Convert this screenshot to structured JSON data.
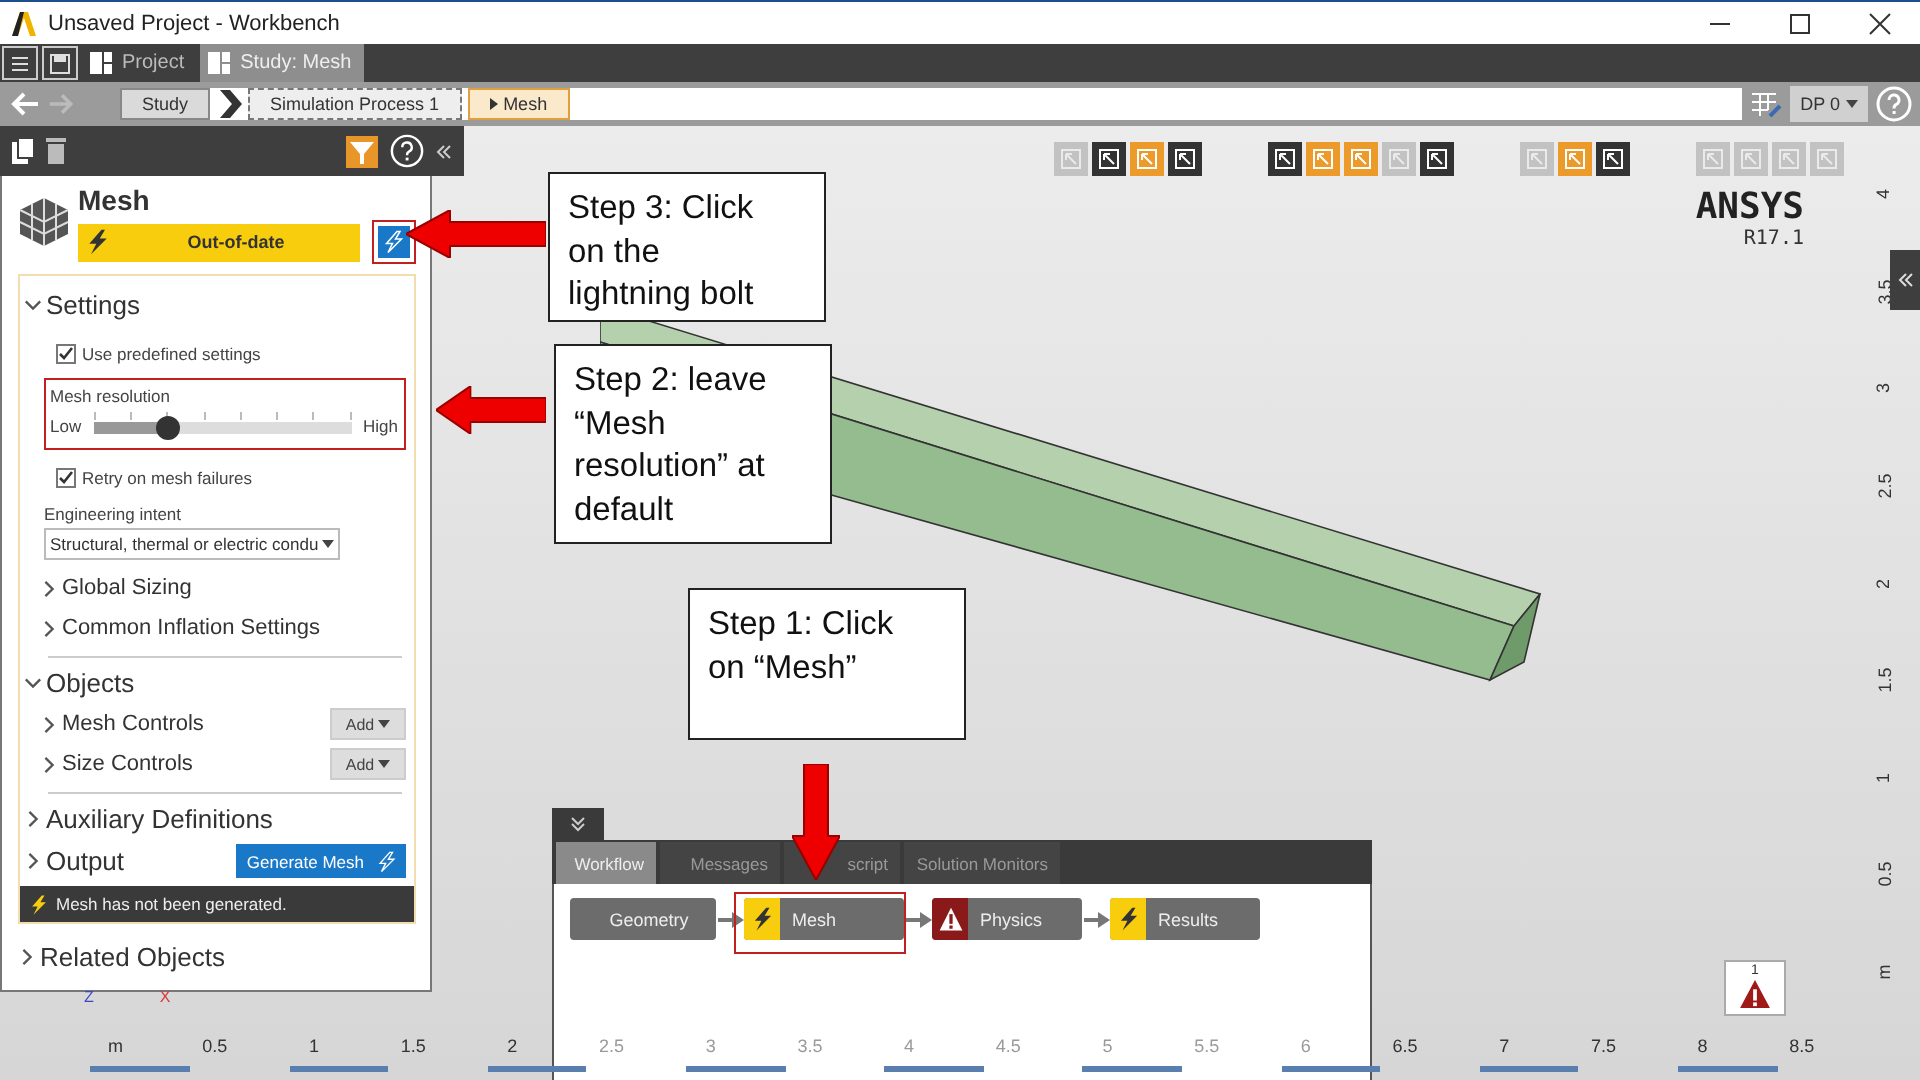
{
  "window": {
    "title": "Unsaved Project - Workbench"
  },
  "app_tabs": [
    {
      "label": "Project",
      "selected": false
    },
    {
      "label": "Study: Mesh",
      "selected": true
    }
  ],
  "breadcrumb": [
    {
      "label": "Study",
      "selected": false
    },
    {
      "label": "Simulation Process 1",
      "selected": false
    },
    {
      "label": "Mesh",
      "selected": true
    }
  ],
  "design_point": "DP 0",
  "panel": {
    "title": "Mesh",
    "status": "Out-of-date",
    "settings": {
      "label": "Settings",
      "expanded": true,
      "use_predefined": {
        "label": "Use predefined settings",
        "checked": true
      },
      "resolution": {
        "label": "Mesh resolution",
        "low": "Low",
        "high": "High",
        "level": 0.29
      },
      "retry": {
        "label": "Retry on mesh failures",
        "checked": true
      },
      "intent": {
        "label": "Engineering intent",
        "value": "Structural, thermal or electric condu"
      },
      "groups": [
        {
          "label": "Global Sizing",
          "expanded": false
        },
        {
          "label": "Common Inflation Settings",
          "expanded": false
        }
      ]
    },
    "objects": {
      "label": "Objects",
      "expanded": true,
      "items": [
        {
          "label": "Mesh Controls",
          "button": "Add",
          "expanded": false
        },
        {
          "label": "Size Controls",
          "button": "Add",
          "expanded": false
        }
      ]
    },
    "auxiliary": {
      "label": "Auxiliary Definitions",
      "expanded": false
    },
    "output": {
      "label": "Output",
      "expanded": false,
      "button": "Generate Mesh",
      "message": "Mesh has not been generated."
    },
    "related": {
      "label": "Related Objects",
      "expanded": false
    }
  },
  "viewport": {
    "toolbar": [
      [
        {
          "active": false,
          "disabled": true
        },
        {
          "active": false,
          "disabled": false
        },
        {
          "active": true,
          "disabled": false
        },
        {
          "active": false,
          "disabled": false
        }
      ],
      [
        {
          "active": false,
          "disabled": false
        },
        {
          "active": true,
          "disabled": false
        },
        {
          "active": true,
          "disabled": false
        },
        {
          "active": false,
          "disabled": true
        },
        {
          "active": false,
          "disabled": false
        }
      ],
      [
        {
          "active": false,
          "disabled": true
        },
        {
          "active": true,
          "disabled": false
        },
        {
          "active": false,
          "disabled": false
        }
      ],
      [
        {
          "active": false,
          "disabled": true
        },
        {
          "active": false,
          "disabled": true
        },
        {
          "active": false,
          "disabled": true
        },
        {
          "active": false,
          "disabled": true
        }
      ]
    ],
    "logo": "ANSYS",
    "version": "R17.1",
    "x_ruler": [
      "m",
      "0.5",
      "1",
      "1.5",
      "2",
      "2.5",
      "3",
      "3.5",
      "4",
      "4.5",
      "5",
      "5.5",
      "6",
      "6.5",
      "7",
      "7.5",
      "8",
      "8.5"
    ],
    "y_ruler": [
      "4",
      "3.5",
      "3",
      "2.5",
      "2",
      "1.5",
      "1",
      "0.5",
      "m"
    ],
    "triad": [
      {
        "label": "Z",
        "color": "#3848c8"
      },
      {
        "label": "X",
        "color": "#d83838"
      }
    ]
  },
  "callouts": [
    {
      "lines": [
        "Step 3: Click",
        "on the",
        "lightning bolt"
      ]
    },
    {
      "lines": [
        "Step 2: leave",
        "“Mesh",
        "resolution” at",
        "default"
      ]
    },
    {
      "lines": [
        "Step 1: Click",
        "on “Mesh”"
      ]
    }
  ],
  "workflow": {
    "tabs": [
      {
        "label": "Workflow",
        "selected": true
      },
      {
        "label": "Messages",
        "selected": false
      },
      {
        "label": "script",
        "selected": false
      },
      {
        "label": "Solution Monitors",
        "selected": false
      }
    ],
    "nodes": [
      {
        "label": "Geometry",
        "outdated": false,
        "error": false,
        "selected": false
      },
      {
        "label": "Mesh",
        "outdated": true,
        "error": false,
        "selected": true
      },
      {
        "label": "Physics",
        "outdated": false,
        "error": true,
        "selected": false
      },
      {
        "label": "Results",
        "outdated": true,
        "error": false,
        "selected": false
      }
    ]
  },
  "badge": {
    "count": "1"
  }
}
